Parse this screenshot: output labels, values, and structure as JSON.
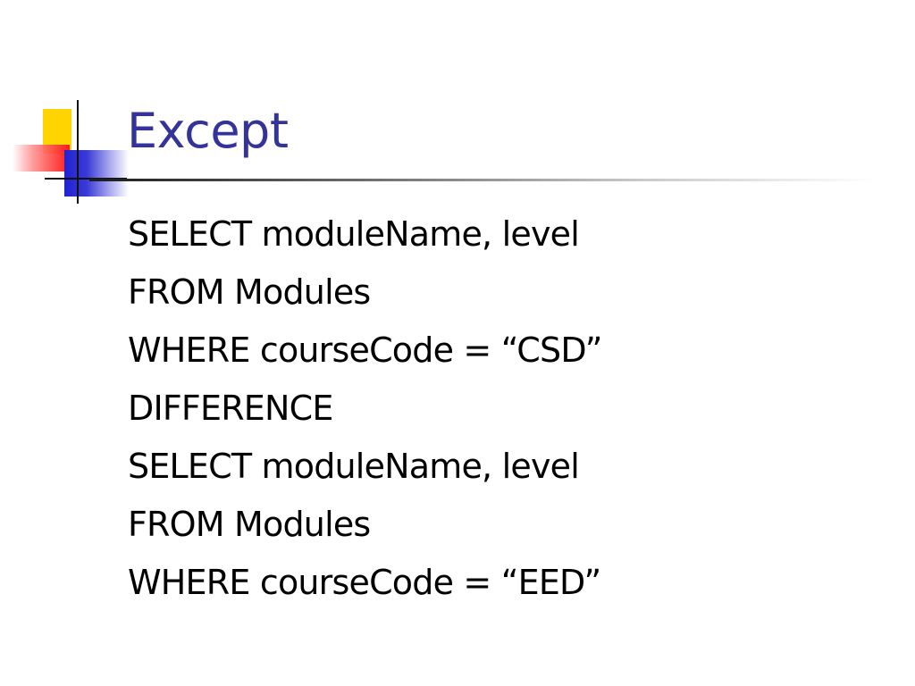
{
  "slide": {
    "title": "Except",
    "lines": [
      "SELECT moduleName, level",
      "FROM Modules",
      "WHERE courseCode = “CSD”",
      "DIFFERENCE",
      "SELECT moduleName, level",
      "FROM Modules",
      "WHERE courseCode = “EED”"
    ]
  },
  "colors": {
    "title": "#333399",
    "text": "#000000",
    "ornament_yellow": "#ffd400",
    "ornament_red": "#ff1a1a",
    "ornament_blue": "#2222d0"
  }
}
